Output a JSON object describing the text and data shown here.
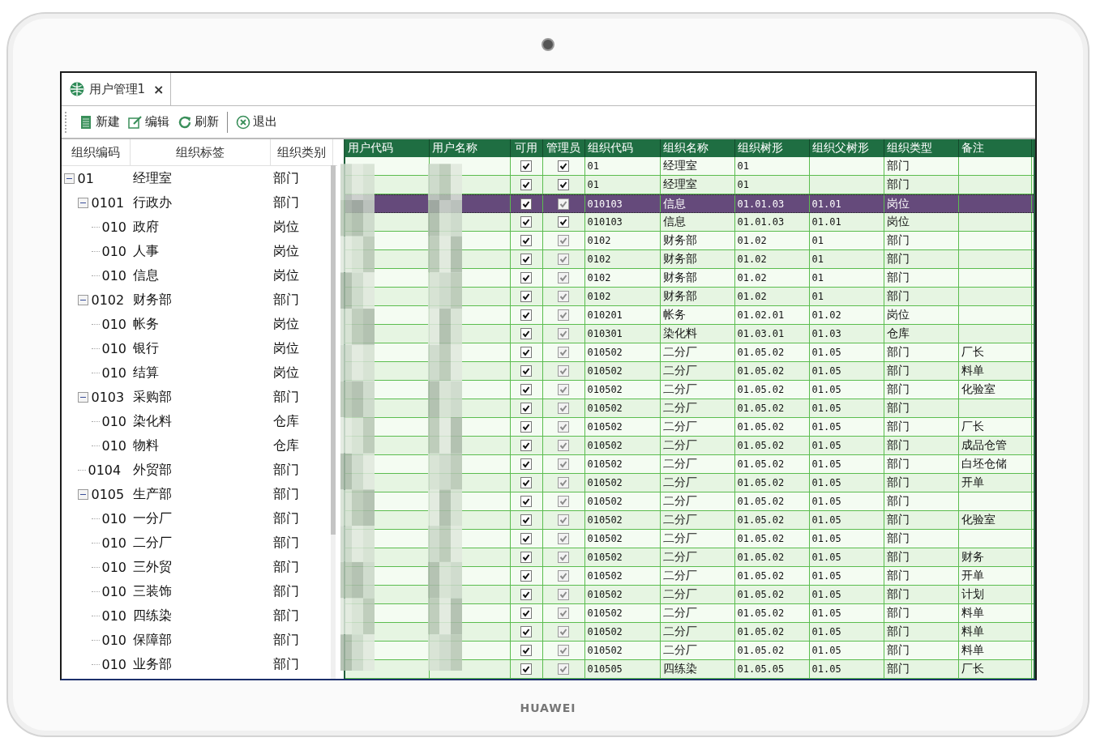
{
  "device": {
    "brand": "HUAWEI"
  },
  "tabs": [
    {
      "label": "用户管理1",
      "close": "×",
      "selected": true
    }
  ],
  "toolbar": [
    {
      "kind": "new",
      "label": "新建"
    },
    {
      "kind": "edit",
      "label": "编辑"
    },
    {
      "kind": "refresh",
      "label": "刷新"
    },
    {
      "kind": "exit",
      "label": "退出"
    }
  ],
  "tree": {
    "columns": [
      "组织编码",
      "组织标签",
      "组织类别"
    ],
    "items": [
      {
        "code": "01",
        "label": "经理室",
        "type": "部门",
        "expanded": true,
        "children": [
          {
            "code": "0101",
            "label": "行政办",
            "type": "部门",
            "expanded": true,
            "children": [
              {
                "code": "010",
                "label": "政府",
                "type": "岗位"
              },
              {
                "code": "010",
                "label": "人事",
                "type": "岗位"
              },
              {
                "code": "010",
                "label": "信息",
                "type": "岗位"
              }
            ]
          },
          {
            "code": "0102",
            "label": "财务部",
            "type": "部门",
            "expanded": true,
            "children": [
              {
                "code": "010",
                "label": "帐务",
                "type": "岗位"
              },
              {
                "code": "010",
                "label": "银行",
                "type": "岗位"
              },
              {
                "code": "010",
                "label": "结算",
                "type": "岗位"
              }
            ]
          },
          {
            "code": "0103",
            "label": "采购部",
            "type": "部门",
            "expanded": true,
            "children": [
              {
                "code": "010",
                "label": "染化料",
                "type": "仓库"
              },
              {
                "code": "010",
                "label": "物料",
                "type": "仓库"
              }
            ]
          },
          {
            "code": "0104",
            "label": "外贸部",
            "type": "部门"
          },
          {
            "code": "0105",
            "label": "生产部",
            "type": "部门",
            "expanded": true,
            "children": [
              {
                "code": "010",
                "label": "一分厂",
                "type": "部门"
              },
              {
                "code": "010",
                "label": "二分厂",
                "type": "部门"
              },
              {
                "code": "010",
                "label": "三外贸",
                "type": "部门"
              },
              {
                "code": "010",
                "label": "三装饰",
                "type": "部门"
              },
              {
                "code": "010",
                "label": "四练染",
                "type": "部门"
              },
              {
                "code": "010",
                "label": "保障部",
                "type": "部门"
              },
              {
                "code": "010",
                "label": "业务部",
                "type": "部门"
              }
            ]
          }
        ]
      }
    ]
  },
  "table": {
    "columns": [
      "用户代码",
      "用户名称",
      "可用",
      "管理员",
      "组织代码",
      "组织名称",
      "组织树形",
      "组织父树形",
      "组织类型",
      "备注"
    ],
    "rows": [
      {
        "enabled": true,
        "admin": true,
        "admin_disabled": false,
        "selected": false,
        "org_code": "01",
        "org_name": "经理室",
        "tree": "01",
        "parent": "",
        "type": "部门",
        "note": ""
      },
      {
        "enabled": true,
        "admin": true,
        "admin_disabled": false,
        "selected": false,
        "org_code": "01",
        "org_name": "经理室",
        "tree": "01",
        "parent": "",
        "type": "部门",
        "note": ""
      },
      {
        "enabled": true,
        "admin": true,
        "admin_disabled": true,
        "selected": true,
        "org_code": "010103",
        "org_name": "信息",
        "tree": "01.01.03",
        "parent": "01.01",
        "type": "岗位",
        "note": ""
      },
      {
        "enabled": true,
        "admin": true,
        "admin_disabled": false,
        "selected": false,
        "org_code": "010103",
        "org_name": "信息",
        "tree": "01.01.03",
        "parent": "01.01",
        "type": "岗位",
        "note": ""
      },
      {
        "enabled": true,
        "admin": true,
        "admin_disabled": true,
        "selected": false,
        "org_code": "0102",
        "org_name": "财务部",
        "tree": "01.02",
        "parent": "01",
        "type": "部门",
        "note": ""
      },
      {
        "enabled": true,
        "admin": true,
        "admin_disabled": true,
        "selected": false,
        "org_code": "0102",
        "org_name": "财务部",
        "tree": "01.02",
        "parent": "01",
        "type": "部门",
        "note": ""
      },
      {
        "enabled": true,
        "admin": true,
        "admin_disabled": true,
        "selected": false,
        "org_code": "0102",
        "org_name": "财务部",
        "tree": "01.02",
        "parent": "01",
        "type": "部门",
        "note": ""
      },
      {
        "enabled": true,
        "admin": true,
        "admin_disabled": true,
        "selected": false,
        "org_code": "0102",
        "org_name": "财务部",
        "tree": "01.02",
        "parent": "01",
        "type": "部门",
        "note": ""
      },
      {
        "enabled": true,
        "admin": true,
        "admin_disabled": true,
        "selected": false,
        "org_code": "010201",
        "org_name": "帐务",
        "tree": "01.02.01",
        "parent": "01.02",
        "type": "岗位",
        "note": ""
      },
      {
        "enabled": true,
        "admin": true,
        "admin_disabled": true,
        "selected": false,
        "org_code": "010301",
        "org_name": "染化料",
        "tree": "01.03.01",
        "parent": "01.03",
        "type": "仓库",
        "note": ""
      },
      {
        "enabled": true,
        "admin": true,
        "admin_disabled": true,
        "selected": false,
        "org_code": "010502",
        "org_name": "二分厂",
        "tree": "01.05.02",
        "parent": "01.05",
        "type": "部门",
        "note": "厂长"
      },
      {
        "enabled": true,
        "admin": true,
        "admin_disabled": true,
        "selected": false,
        "org_code": "010502",
        "org_name": "二分厂",
        "tree": "01.05.02",
        "parent": "01.05",
        "type": "部门",
        "note": "料单"
      },
      {
        "enabled": true,
        "admin": true,
        "admin_disabled": true,
        "selected": false,
        "org_code": "010502",
        "org_name": "二分厂",
        "tree": "01.05.02",
        "parent": "01.05",
        "type": "部门",
        "note": "化验室"
      },
      {
        "enabled": true,
        "admin": true,
        "admin_disabled": true,
        "selected": false,
        "org_code": "010502",
        "org_name": "二分厂",
        "tree": "01.05.02",
        "parent": "01.05",
        "type": "部门",
        "note": ""
      },
      {
        "enabled": true,
        "admin": true,
        "admin_disabled": true,
        "selected": false,
        "org_code": "010502",
        "org_name": "二分厂",
        "tree": "01.05.02",
        "parent": "01.05",
        "type": "部门",
        "note": "厂长"
      },
      {
        "enabled": true,
        "admin": true,
        "admin_disabled": true,
        "selected": false,
        "org_code": "010502",
        "org_name": "二分厂",
        "tree": "01.05.02",
        "parent": "01.05",
        "type": "部门",
        "note": "成品仓管"
      },
      {
        "enabled": true,
        "admin": true,
        "admin_disabled": true,
        "selected": false,
        "org_code": "010502",
        "org_name": "二分厂",
        "tree": "01.05.02",
        "parent": "01.05",
        "type": "部门",
        "note": "白坯仓储"
      },
      {
        "enabled": true,
        "admin": true,
        "admin_disabled": true,
        "selected": false,
        "org_code": "010502",
        "org_name": "二分厂",
        "tree": "01.05.02",
        "parent": "01.05",
        "type": "部门",
        "note": "开单"
      },
      {
        "enabled": true,
        "admin": true,
        "admin_disabled": true,
        "selected": false,
        "org_code": "010502",
        "org_name": "二分厂",
        "tree": "01.05.02",
        "parent": "01.05",
        "type": "部门",
        "note": ""
      },
      {
        "enabled": true,
        "admin": true,
        "admin_disabled": true,
        "selected": false,
        "org_code": "010502",
        "org_name": "二分厂",
        "tree": "01.05.02",
        "parent": "01.05",
        "type": "部门",
        "note": "化验室"
      },
      {
        "enabled": true,
        "admin": true,
        "admin_disabled": true,
        "selected": false,
        "org_code": "010502",
        "org_name": "二分厂",
        "tree": "01.05.02",
        "parent": "01.05",
        "type": "部门",
        "note": ""
      },
      {
        "enabled": true,
        "admin": true,
        "admin_disabled": true,
        "selected": false,
        "org_code": "010502",
        "org_name": "二分厂",
        "tree": "01.05.02",
        "parent": "01.05",
        "type": "部门",
        "note": "财务"
      },
      {
        "enabled": true,
        "admin": true,
        "admin_disabled": true,
        "selected": false,
        "org_code": "010502",
        "org_name": "二分厂",
        "tree": "01.05.02",
        "parent": "01.05",
        "type": "部门",
        "note": "开单"
      },
      {
        "enabled": true,
        "admin": true,
        "admin_disabled": true,
        "selected": false,
        "org_code": "010502",
        "org_name": "二分厂",
        "tree": "01.05.02",
        "parent": "01.05",
        "type": "部门",
        "note": "计划"
      },
      {
        "enabled": true,
        "admin": true,
        "admin_disabled": true,
        "selected": false,
        "org_code": "010502",
        "org_name": "二分厂",
        "tree": "01.05.02",
        "parent": "01.05",
        "type": "部门",
        "note": "料单"
      },
      {
        "enabled": true,
        "admin": true,
        "admin_disabled": true,
        "selected": false,
        "org_code": "010502",
        "org_name": "二分厂",
        "tree": "01.05.02",
        "parent": "01.05",
        "type": "部门",
        "note": "料单"
      },
      {
        "enabled": true,
        "admin": true,
        "admin_disabled": true,
        "selected": false,
        "org_code": "010502",
        "org_name": "二分厂",
        "tree": "01.05.02",
        "parent": "01.05",
        "type": "部门",
        "note": "料单"
      },
      {
        "enabled": true,
        "admin": true,
        "admin_disabled": true,
        "selected": false,
        "org_code": "010505",
        "org_name": "四练染",
        "tree": "01.05.05",
        "parent": "01.05",
        "type": "部门",
        "note": "厂长"
      }
    ]
  }
}
